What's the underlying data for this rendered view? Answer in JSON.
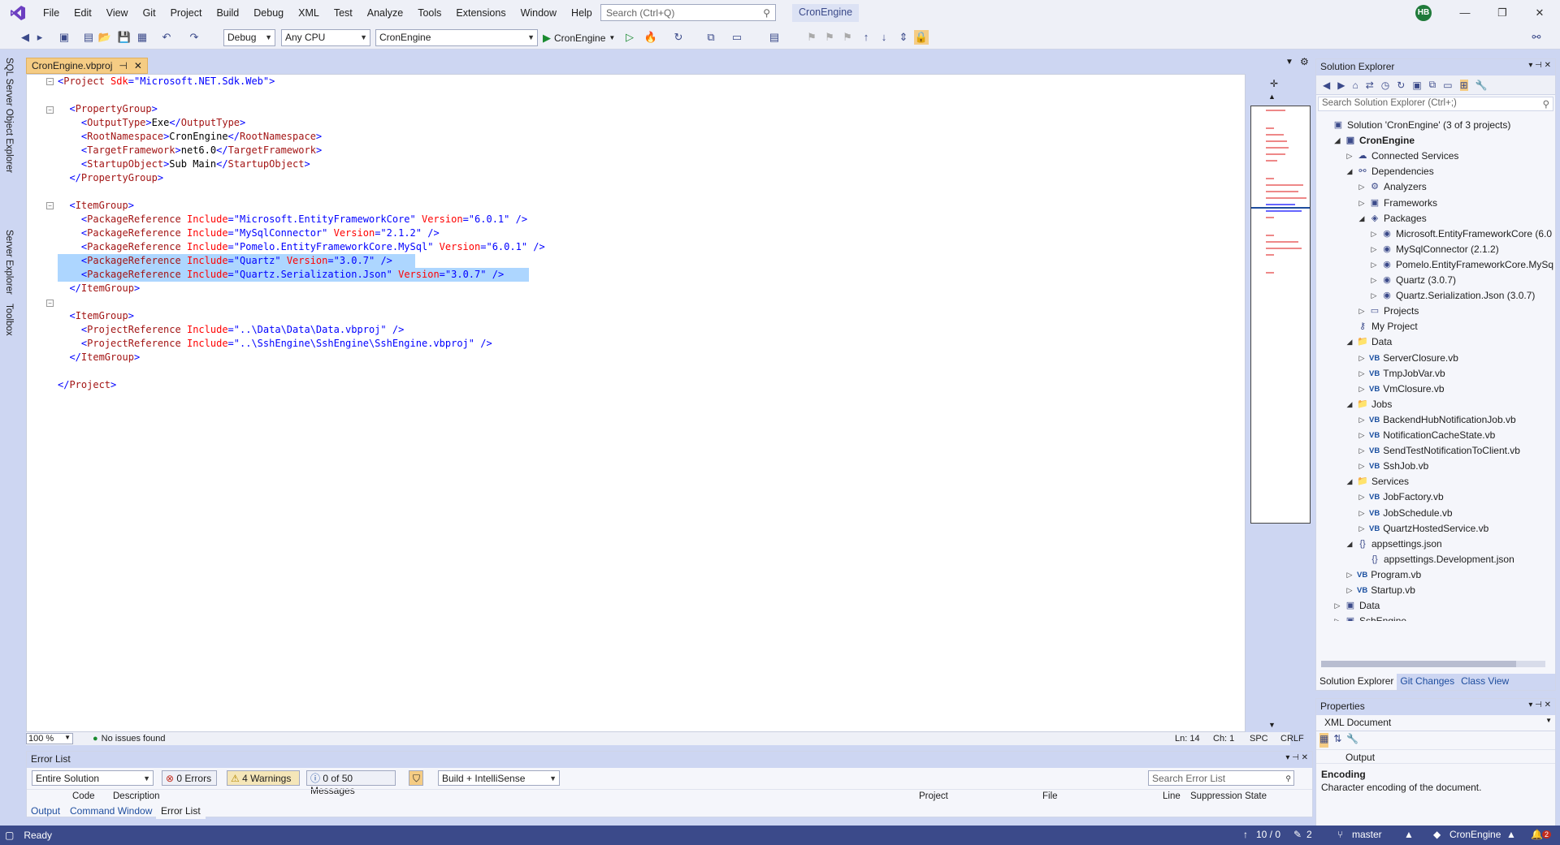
{
  "menu": [
    "File",
    "Edit",
    "View",
    "Git",
    "Project",
    "Build",
    "Debug",
    "XML",
    "Test",
    "Analyze",
    "Tools",
    "Extensions",
    "Window",
    "Help"
  ],
  "search_placeholder": "Search (Ctrl+Q)",
  "solution_name_badge": "CronEngine",
  "user_initials": "HB",
  "toolbar": {
    "config": "Debug",
    "platform": "Any CPU",
    "startup_project": "CronEngine",
    "run_label": "CronEngine"
  },
  "left_tabs": [
    "SQL Server Object Explorer",
    "Server Explorer",
    "Toolbox"
  ],
  "editor": {
    "tab_title": "CronEngine.vbproj",
    "zoom": "100 %",
    "issues": "No issues found",
    "ln": "Ln: 14",
    "ch": "Ch: 1",
    "spc": "SPC",
    "crlf": "CRLF"
  },
  "code": {
    "l1_tag": "Project",
    "l1_attr": "Sdk",
    "l1_val": "\"Microsoft.NET.Sdk.Web\"",
    "pg": "PropertyGroup",
    "ot": "OutputType",
    "ot_v": "Exe",
    "rn": "RootNamespace",
    "rn_v": "CronEngine",
    "tf": "TargetFramework",
    "tf_v": "net6.0",
    "so": "StartupObject",
    "so_v": "Sub Main",
    "ig": "ItemGroup",
    "pr": "PackageReference",
    "inc": "Include",
    "ver": "Version",
    "p1": "\"Microsoft.EntityFrameworkCore\"",
    "p1v": "\"6.0.1\"",
    "p2": "\"MySqlConnector\"",
    "p2v": "\"2.1.2\"",
    "p3": "\"Pomelo.EntityFrameworkCore.MySql\"",
    "p3v": "\"6.0.1\"",
    "p4": "\"Quartz\"",
    "p4v": "\"3.0.7\"",
    "p5": "\"Quartz.Serialization.Json\"",
    "p5v": "\"3.0.7\"",
    "projref": "ProjectReference",
    "r1": "\"..\\Data\\Data\\Data.vbproj\"",
    "r2": "\"..\\SshEngine\\SshEngine\\SshEngine.vbproj\""
  },
  "solution_explorer": {
    "title": "Solution Explorer",
    "search_placeholder": "Search Solution Explorer (Ctrl+;)",
    "items": [
      "Solution 'CronEngine' (3 of 3 projects)",
      "CronEngine",
      "Connected Services",
      "Dependencies",
      "Analyzers",
      "Frameworks",
      "Packages",
      "Microsoft.EntityFrameworkCore (6.0",
      "MySqlConnector (2.1.2)",
      "Pomelo.EntityFrameworkCore.MySq",
      "Quartz (3.0.7)",
      "Quartz.Serialization.Json (3.0.7)",
      "Projects",
      "My Project",
      "Data",
      "ServerClosure.vb",
      "TmpJobVar.vb",
      "VmClosure.vb",
      "Jobs",
      "BackendHubNotificationJob.vb",
      "NotificationCacheState.vb",
      "SendTestNotificationToClient.vb",
      "SshJob.vb",
      "Services",
      "JobFactory.vb",
      "JobSchedule.vb",
      "QuartzHostedService.vb",
      "appsettings.json",
      "appsettings.Development.json",
      "Program.vb",
      "Startup.vb",
      "Data",
      "SshEngine"
    ],
    "tabs": [
      "Solution Explorer",
      "Git Changes",
      "Class View"
    ]
  },
  "properties": {
    "title": "Properties",
    "object": "XML Document",
    "row_name": "Output",
    "desc_title": "Encoding",
    "desc_text": "Character encoding of the document."
  },
  "error_list": {
    "title": "Error List",
    "scope": "Entire Solution",
    "errors": "0 Errors",
    "warnings": "4 Warnings",
    "messages": "0 of 50 Messages",
    "source": "Build + IntelliSense",
    "search_placeholder": "Search Error List",
    "columns": [
      "Code",
      "Description",
      "Project",
      "File",
      "Line",
      "Suppression State"
    ]
  },
  "bottom_tabs": [
    "Output",
    "Command Window",
    "Error List"
  ],
  "status": {
    "ready": "Ready",
    "position": "10 / 0",
    "changes": "2",
    "branch": "master",
    "repo": "CronEngine",
    "notifications": "2"
  }
}
